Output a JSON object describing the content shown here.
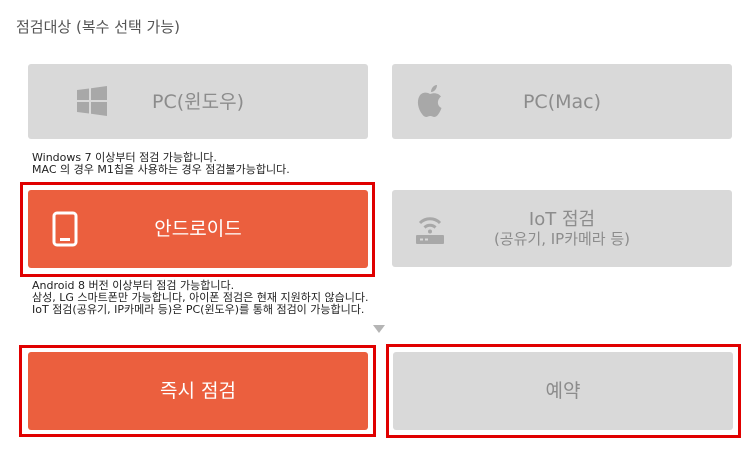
{
  "section_title": "점검대상 (복수 선택 가능)",
  "colors": {
    "accent": "#eb5f3e",
    "tile_inactive": "#d9d9d9",
    "highlight": "#e00000"
  },
  "tiles": {
    "pc_windows": {
      "label": "PC(윈도우)",
      "icon": "windows-icon",
      "selected": false
    },
    "pc_mac": {
      "label": "PC(Mac)",
      "icon": "apple-icon",
      "selected": false
    },
    "android": {
      "label": "안드로이드",
      "icon": "tablet-icon",
      "selected": true
    },
    "iot": {
      "label": "IoT 점검",
      "sublabel": "(공유기, IP카메라 등)",
      "icon": "router-icon",
      "selected": false
    }
  },
  "notes": {
    "pc": [
      "Windows 7 이상부터 점검 가능합니다.",
      "MAC 의 경우 M1칩을 사용하는 경우 점검불가능합니다."
    ],
    "mobile": [
      "Android 8 버전 이상부터 점검 가능합니다.",
      "삼성, LG 스마트폰만 가능합니다, 아이폰 점검은 현재 지원하지 않습니다.",
      "IoT 점검(공유기, IP카메라 등)은 PC(윈도우)를 통해 점검이 가능합니다."
    ]
  },
  "actions": {
    "instant_label": "즉시 점검",
    "schedule_label": "예약"
  }
}
